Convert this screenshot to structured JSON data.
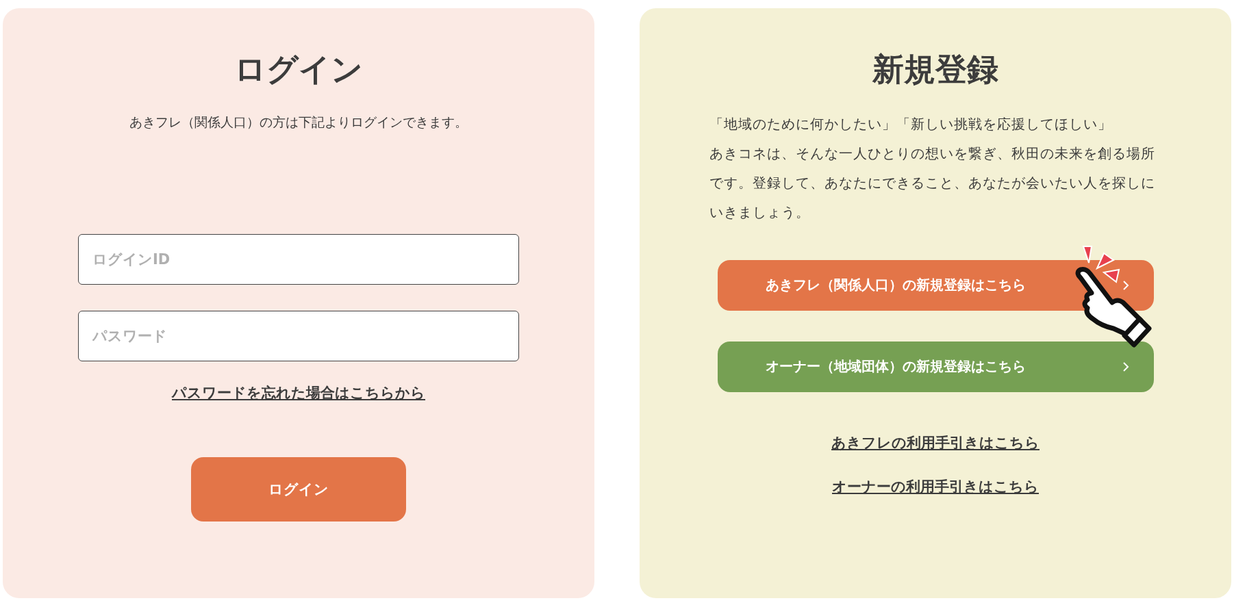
{
  "login": {
    "title": "ログイン",
    "description": "あきフレ（関係人口）の方は下記よりログインできます。",
    "fields": [
      {
        "placeholder": "ログインID"
      },
      {
        "placeholder": "パスワード"
      }
    ],
    "forgot_link": "パスワードを忘れた場合はこちらから",
    "button": "ログイン"
  },
  "register": {
    "title": "新規登録",
    "paragraphs": [
      "「地域のために何かしたい」「新しい挑戦を応援してほしい」",
      "あきコネは、そんな一人ひとりの想いを繋ぎ、秋田の未来を創る場所です。登録して、あなたにできること、あなたが会いたい人を探しにいきましょう。"
    ],
    "buttons": [
      {
        "label": "あきフレ（関係人口）の新規登録はこちら",
        "color": "#e37548"
      },
      {
        "label": "オーナー（地域団体）の新規登録はこちら",
        "color": "#76a053"
      }
    ],
    "links": [
      "あきフレの利用手引きはこちら",
      "オーナーの利用手引きはこちら"
    ]
  }
}
